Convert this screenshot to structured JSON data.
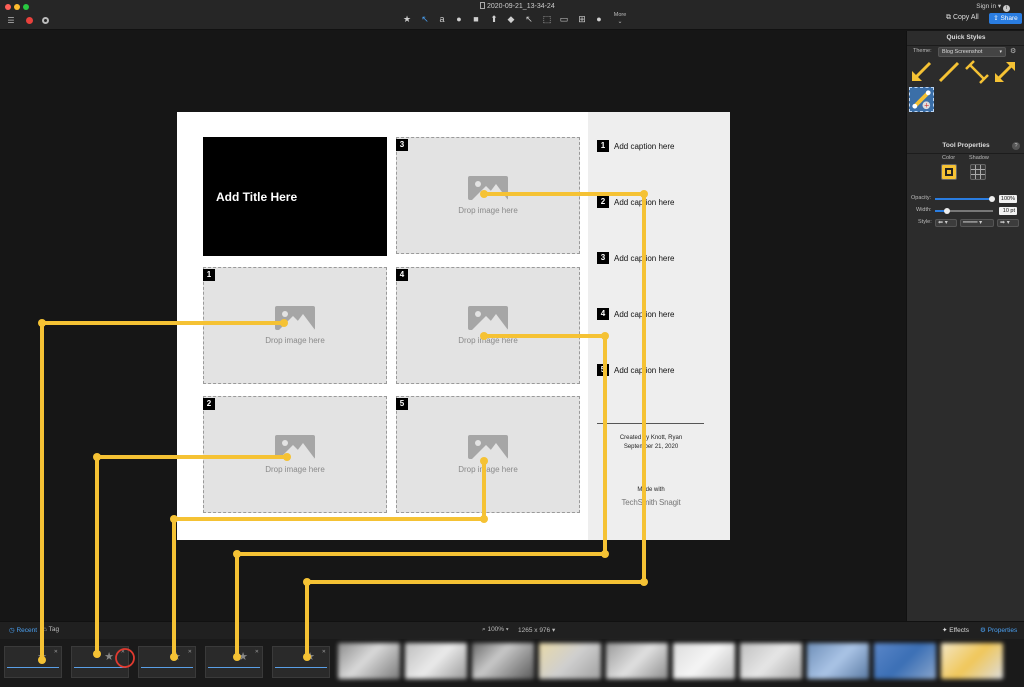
{
  "titlebar": {
    "document_title": "2020-09-21_13-34-24",
    "signin": "Sign in ▾",
    "more": "More",
    "copy_all": "Copy All",
    "share": "Share",
    "tools": [
      "favorites-star-icon",
      "arrow-icon",
      "text-a-icon",
      "callout-icon",
      "shape-icon",
      "stamp-icon",
      "fill-icon",
      "move-icon",
      "selection-icon",
      "crop-icon",
      "magnify-icon",
      "blur-drop-icon"
    ]
  },
  "template": {
    "title": "Add Title Here",
    "drop_text": "Drop image here",
    "slots": [
      {
        "number": "3"
      },
      {
        "number": "1"
      },
      {
        "number": "4"
      },
      {
        "number": "2"
      },
      {
        "number": "5"
      }
    ],
    "captions": [
      {
        "number": "1",
        "text": "Add caption here"
      },
      {
        "number": "2",
        "text": "Add caption here"
      },
      {
        "number": "3",
        "text": "Add caption here"
      },
      {
        "number": "4",
        "text": "Add caption here"
      },
      {
        "number": "5",
        "text": "Add caption here"
      }
    ],
    "created_line1": "Created by Knott, Ryan",
    "created_line2": "September 21, 2020",
    "made_with": "Made with",
    "brand": "TechSmith Snagit"
  },
  "annotation_color": "#f5c234",
  "right_panel": {
    "quick_styles_title": "Quick Styles",
    "theme_label": "Theme:",
    "theme_value": "Blog Screenshot",
    "tool_properties_title": "Tool Properties",
    "color_label": "Color",
    "shadow_label": "Shadow",
    "opacity_label": "Opacity:",
    "opacity_value": "100%",
    "width_label": "Width:",
    "width_value": "10 pt",
    "style_label": "Style:"
  },
  "bottom_bar": {
    "recent": "Recent",
    "tag": "Tag",
    "zoom": "100% ▾",
    "dimensions": "1265 x 976 ▾",
    "effects": "Effects",
    "properties": "Properties"
  }
}
